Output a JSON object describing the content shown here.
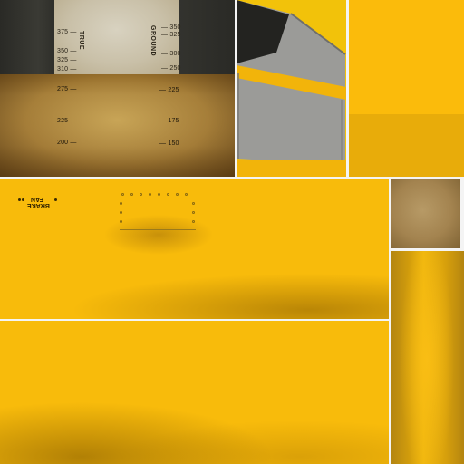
{
  "gauge": {
    "labels": {
      "left_vertical": "TRUE",
      "right_vertical": "GROUND"
    },
    "left_scale": [
      "375",
      "350",
      "325",
      "310",
      "275",
      "225",
      "200"
    ],
    "right_scale": [
      "350",
      "325",
      "300",
      "250",
      "225",
      "175",
      "150"
    ]
  },
  "decal": {
    "line1": "FAN",
    "line2": "BRAKE"
  },
  "colors": {
    "yellow": "#f8bb0b",
    "dark_yellow": "#e8ac0a",
    "gray": "#9a9a98",
    "frame": "#2e2d28",
    "tan": "#a3834f"
  }
}
